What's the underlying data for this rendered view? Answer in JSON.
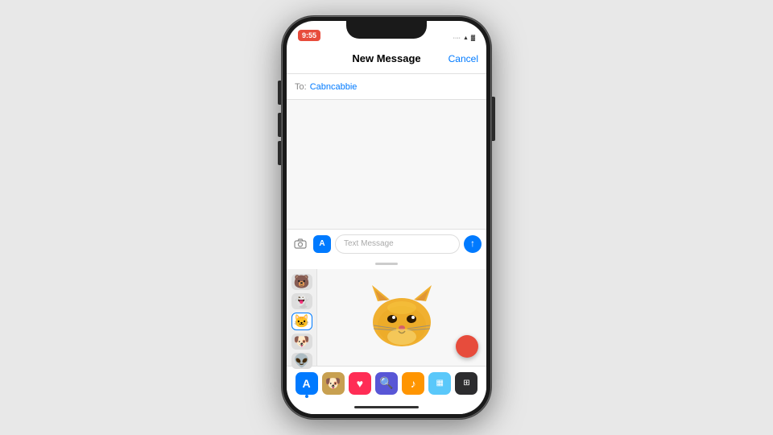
{
  "status_bar": {
    "time": "9:55",
    "signal": "●●●●",
    "wifi": "WiFi",
    "battery": "Battery"
  },
  "nav": {
    "title": "New Message",
    "cancel_label": "Cancel"
  },
  "to_field": {
    "label": "To:",
    "contact": "Cabncabbie"
  },
  "input": {
    "placeholder": "Text Message"
  },
  "animoji": {
    "items": [
      "🐻",
      "👻",
      "🐱",
      "🐶",
      "👽"
    ],
    "active_index": 2
  },
  "dock": {
    "items": [
      "A",
      "🐶",
      "❤️",
      "🔍",
      "♪",
      "▦",
      "⊞"
    ]
  },
  "record_button": {
    "color": "#e74c3c"
  }
}
